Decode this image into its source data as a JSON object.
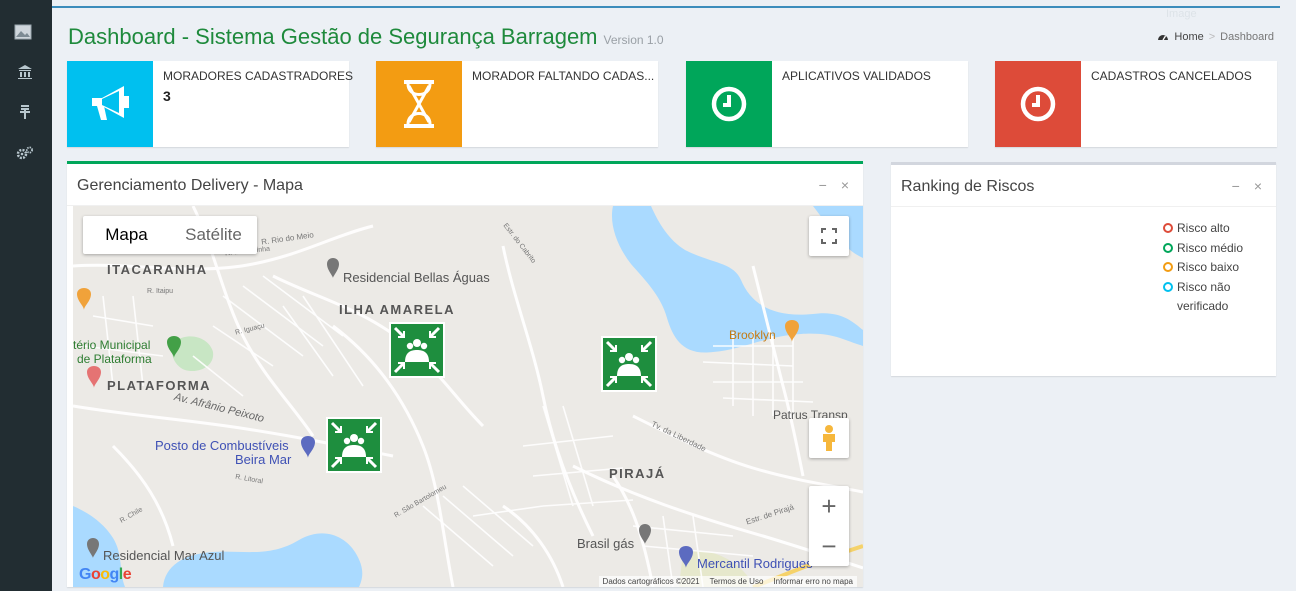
{
  "header": {
    "title": "Dashboard - Sistema Gestão de Segurança Barragem",
    "version": "Version 1.0",
    "image_alt": "Image",
    "breadcrumb": {
      "home": "Home",
      "separator": ">",
      "current": "Dashboard"
    }
  },
  "sidebar": {
    "icons": [
      "broken-image-icon",
      "bank-icon",
      "money-icon",
      "cogs-icon"
    ]
  },
  "info_boxes": [
    {
      "label": "MORADORES CADASTRADORES",
      "value": "3",
      "color": "#00c0ef",
      "icon": "bullhorn-icon"
    },
    {
      "label": "MORADOR FALTANDO CADAS...",
      "value": "",
      "color": "#f39c12",
      "icon": "hourglass-icon"
    },
    {
      "label": "APLICATIVOS VALIDADOS",
      "value": "",
      "color": "#00a65a",
      "icon": "clock-icon"
    },
    {
      "label": "CADASTROS CANCELADOS",
      "value": "",
      "color": "#dd4b39",
      "icon": "clock-icon"
    }
  ],
  "map_panel": {
    "title": "Gerenciamento Delivery - Mapa",
    "accent": "#00a65a",
    "map_type": {
      "map": "Mapa",
      "satellite": "Satélite"
    },
    "zoom_in": "+",
    "zoom_out": "−",
    "attribution": [
      "Dados cartográficos ©2021",
      "Termos de Uso",
      "Informar erro no mapa"
    ],
    "logo": "Google",
    "labels": {
      "itacaranha": "ITACARANHA",
      "ilha_amarela": "ILHA AMARELA",
      "plataforma": "PLATAFORMA",
      "piraja": "PIRAJÁ",
      "bellas_aguas": "Residencial Bellas Águas",
      "brooklyn": "Brooklyn",
      "cemiterio": "tério Municipal",
      "cemiterio2": "de Plataforma",
      "posto": "Posto de Combustíveis",
      "posto2": "Beira Mar",
      "patrus": "Patrus Transp",
      "brasil_gas": "Brasil gás",
      "mercantil": "Mercantil Rodrigues",
      "mar_azul": "Residencial Mar Azul",
      "afranio": "Av. Afrânio Peixoto",
      "liberdade": "Tv. da Liberdade",
      "estr_piraja": "Estr. de Pirajá",
      "rio_do_meio": "R. Rio do Meio",
      "serrinha": "R. da Serrinha",
      "estr_cabrito": "Estr. do Cabrito",
      "itaipu": "R. Itaipu",
      "iguacu": "R. Iguaçu",
      "litoral": "R. Litoral",
      "chile": "R. Chile",
      "sao_bartolomeu": "R. São Bartolomeu"
    }
  },
  "ranking_panel": {
    "title": "Ranking de Riscos",
    "legend": [
      {
        "label": "Risco alto",
        "color": "#dd4b39"
      },
      {
        "label": "Risco médio",
        "color": "#00a65a"
      },
      {
        "label": "Risco baixo",
        "color": "#f39c12"
      },
      {
        "label": "Risco não verificado",
        "color": "#00c0ef"
      }
    ]
  },
  "colors": {
    "accent_green": "#00a65a",
    "title_green": "#1e8a3c",
    "sidebar": "#222d32"
  }
}
